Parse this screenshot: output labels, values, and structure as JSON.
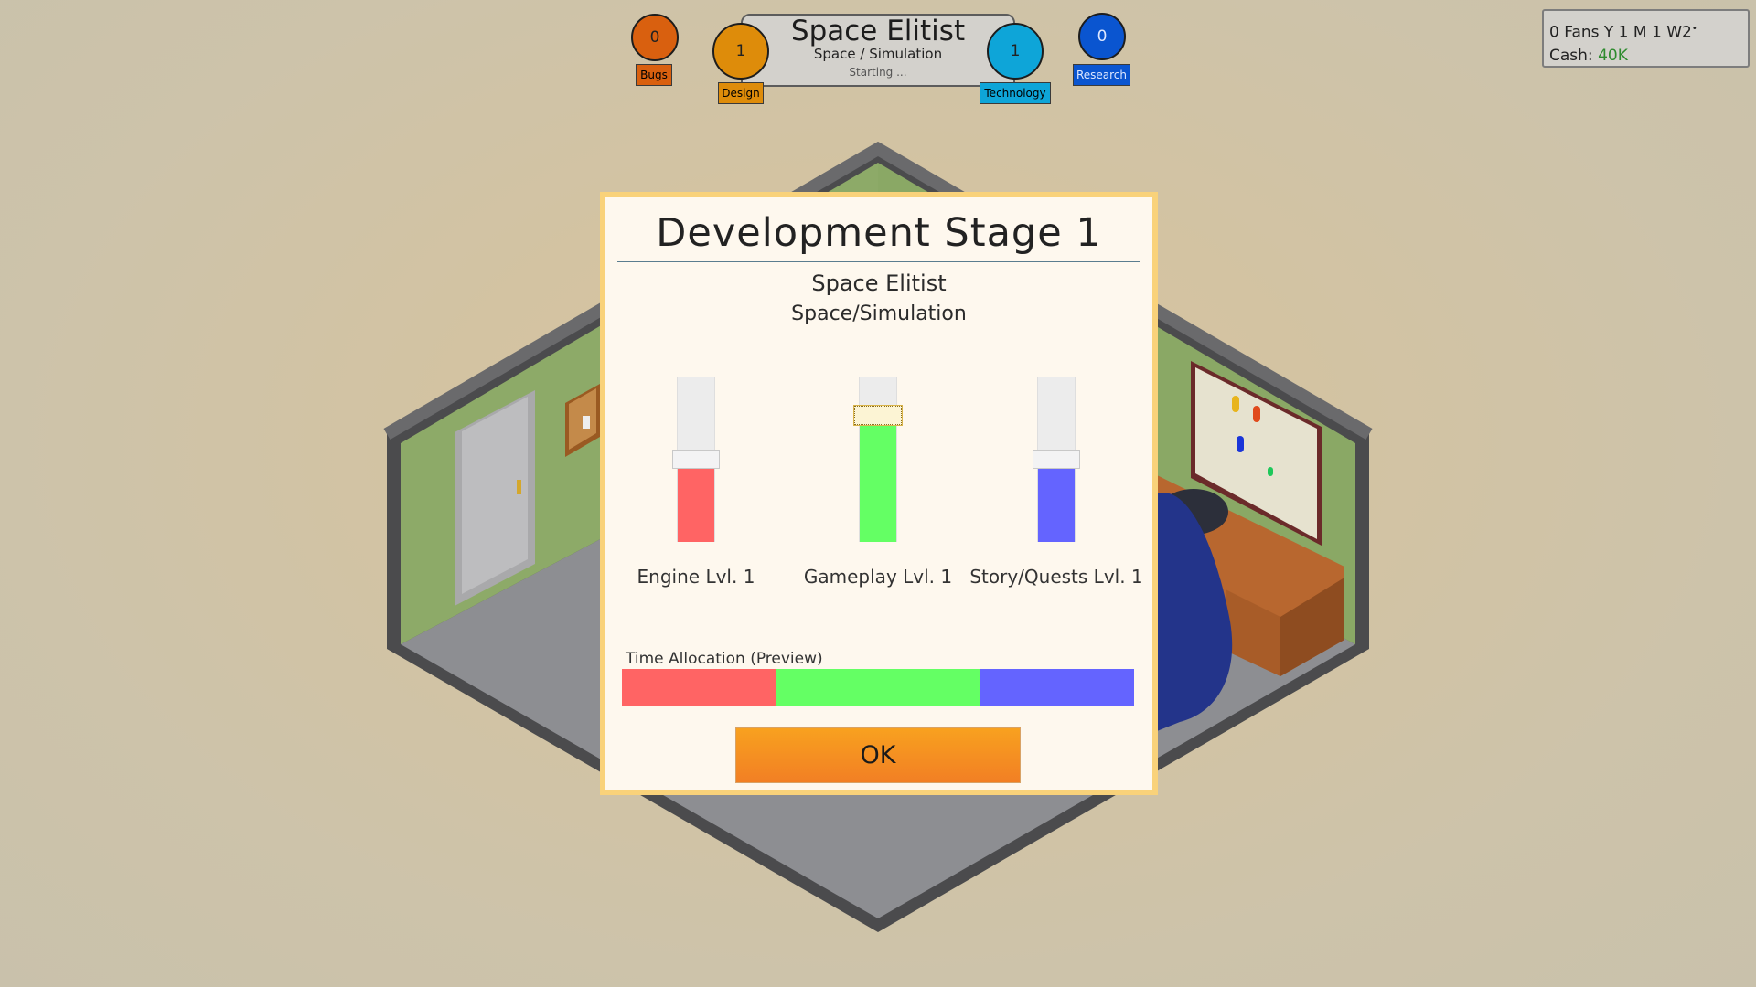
{
  "hud": {
    "bugs": {
      "value": "0",
      "label": "Bugs",
      "color": "#d9600f"
    },
    "design": {
      "value": "1",
      "label": "Design",
      "color": "#de8c0a"
    },
    "technology": {
      "value": "1",
      "label": "Technology",
      "color": "#0ea5d8"
    },
    "research": {
      "value": "0",
      "label": "Research",
      "color": "#0a55d0"
    },
    "game_title": "Space Elitist",
    "game_genre": "Space / Simulation",
    "game_status": "Starting ..."
  },
  "info": {
    "line1": "0 Fans Y 1 M 1 W2",
    "line1_marker": "•",
    "cash_label": "Cash: ",
    "cash_value": "40K"
  },
  "dialog": {
    "title": "Development Stage 1",
    "game_name": "Space Elitist",
    "game_genre": "Space/Simulation",
    "sliders": [
      {
        "label": "Engine Lvl. 1",
        "value": 0.5,
        "color": "#ff6464",
        "focused": false
      },
      {
        "label": "Gameplay Lvl. 1",
        "value": 0.8,
        "color": "#64ff64",
        "focused": true
      },
      {
        "label": "Story/Quests Lvl. 1",
        "value": 0.5,
        "color": "#6464ff",
        "focused": false
      }
    ],
    "allocation_label": "Time Allocation (Preview)",
    "allocation": [
      {
        "name": "Engine",
        "percent": 30,
        "color": "#ff6464"
      },
      {
        "name": "Gameplay",
        "percent": 40,
        "color": "#64ff64"
      },
      {
        "name": "Story/Quests",
        "percent": 30,
        "color": "#6464ff"
      }
    ],
    "ok_label": "OK"
  }
}
